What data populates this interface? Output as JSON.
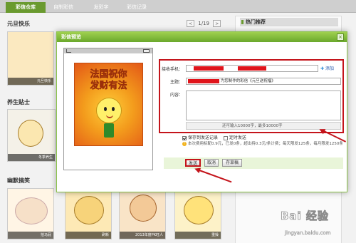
{
  "tabs": [
    {
      "label": "彩信仓库"
    },
    {
      "label": "自制彩信"
    },
    {
      "label": "发彩字"
    },
    {
      "label": "彩信记录"
    }
  ],
  "sections": [
    {
      "title": "元旦快乐",
      "cards": [
        {
          "caption": "元旦快乐"
        }
      ]
    },
    {
      "title": "养生贴士",
      "cards": [
        {
          "caption": "冬季养生"
        }
      ]
    },
    {
      "title": "幽默搞笑",
      "cards": [
        {
          "caption": "拍马屁"
        },
        {
          "caption": "刷新"
        },
        {
          "caption": "2013年度PK旺人"
        },
        {
          "caption": "重操"
        }
      ]
    }
  ],
  "pager": {
    "text": "1/19",
    "prev": "<",
    "next": ">"
  },
  "right_panel": {
    "title": "热门推荐"
  },
  "dialog": {
    "title": "彩信预览",
    "close": "×",
    "poster_line1": "法国祝你",
    "poster_line2": "发财有法",
    "fields": {
      "recipient_label": "接收手机：",
      "add_label": "添加",
      "subject_label": "主题：",
      "subject_value": "为您制作的彩信《元旦送祝福》",
      "content_label": "内容：",
      "counter_text": "还可输入10000字，最多10000字"
    },
    "options": {
      "save_label": "保存到发送记录",
      "save_checked": true,
      "timed_label": "定时发送",
      "timed_checked": false
    },
    "note": "本次费用标配0.9元，已发0条，超出持0.3元/条计费；每天限发125条，每月限发1250条",
    "buttons": {
      "send": "发送",
      "cancel": "取消",
      "draft": "存草稿"
    }
  },
  "watermark": {
    "logo": "Bai 经验",
    "url": "jingyan.baidu.com"
  },
  "colors": {
    "accent": "#6a9a2f",
    "highlight": "#c4141b"
  }
}
